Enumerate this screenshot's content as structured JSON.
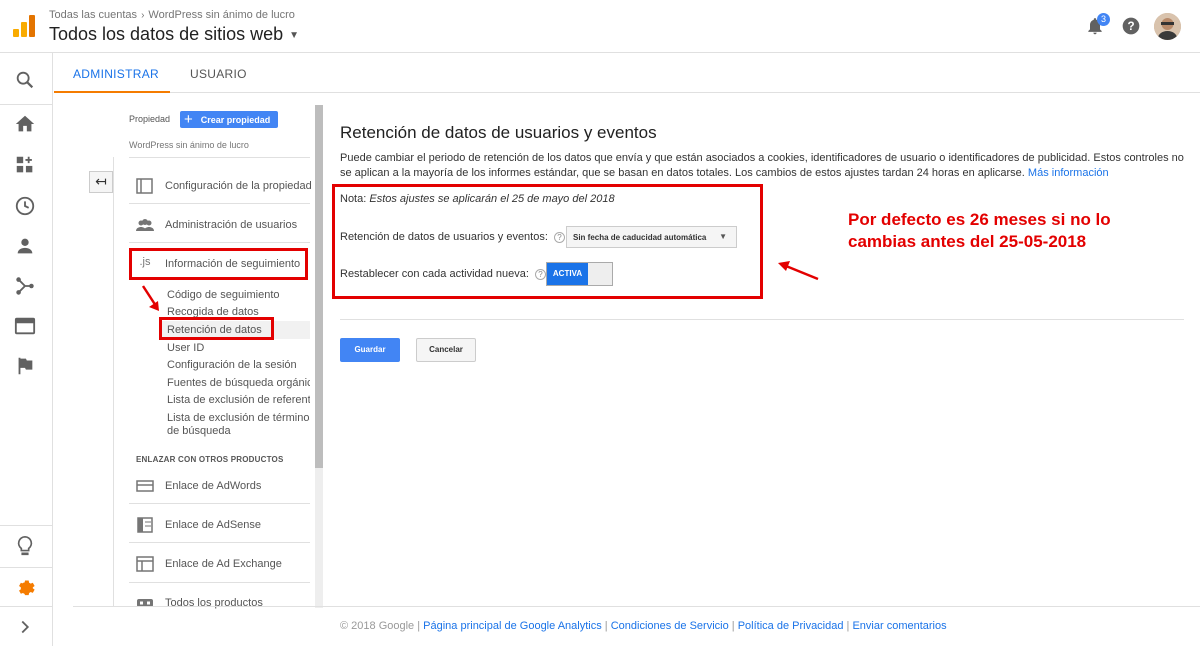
{
  "header": {
    "breadcrumb": [
      "Todas las cuentas",
      "WordPress sin ánimo de lucro"
    ],
    "title": "Todos los datos de sitios web",
    "notification_count": "3",
    "icons": [
      "analytics-logo",
      "bell-icon",
      "help-icon",
      "avatar"
    ]
  },
  "leftnav": {
    "icons": [
      "search-icon",
      "home-icon",
      "customization-icon",
      "clock-icon",
      "person-icon",
      "acquisition-icon",
      "behavior-icon",
      "flag-icon",
      "lightbulb-icon",
      "gear-icon",
      "expand-icon"
    ]
  },
  "tabs": {
    "admin": "ADMINISTRAR",
    "user": "USUARIO"
  },
  "property": {
    "label": "Propiedad",
    "create_button": "Crear propiedad",
    "name": "WordPress sin ánimo de lucro"
  },
  "menu": {
    "config": "Configuración de la propiedad",
    "users": "Administración de usuarios",
    "tracking": "Información de seguimiento",
    "tracking_icon": ".js",
    "subitems": {
      "code": "Código de seguimiento",
      "collection": "Recogida de datos",
      "retention": "Retención de datos",
      "userid": "User ID",
      "session": "Configuración de la sesión",
      "organic": "Fuentes de búsqueda orgánic",
      "referral": "Lista de exclusión de referent",
      "terms_1": "Lista de exclusión de términos",
      "terms_2": "de búsqueda"
    },
    "section_header": "ENLAZAR CON OTROS PRODUCTOS",
    "adwords": "Enlace de AdWords",
    "adsense": "Enlace de AdSense",
    "adexchange": "Enlace de Ad Exchange",
    "allproducts": "Todos los productos"
  },
  "main": {
    "title": "Retención de datos de usuarios y eventos",
    "description": "Puede cambiar el periodo de retención de los datos que envía y que están asociados a cookies, identificadores de usuario o identificadores de publicidad. Estos controles no se aplican a la mayoría de los informes estándar, que se basan en datos totales. Los cambios de estos ajustes tardan 24 horas en aplicarse.",
    "more_info": "Más información",
    "nota_label": "Nota:",
    "nota_text": "Estos ajustes se aplicarán el 25 de mayo del 2018",
    "retention_label": "Retención de datos de usuarios y eventos:",
    "retention_value": "Sin fecha de caducidad automática",
    "reset_label": "Restablecer con cada actividad nueva:",
    "toggle_state": "ACTIVA",
    "help_mark": "?",
    "save": "Guardar",
    "cancel": "Cancelar"
  },
  "annotation": {
    "line1": "Por defecto es 26 meses si no lo",
    "line2": "cambias antes del 25-05-2018"
  },
  "footer": {
    "copyright": "© 2018 Google",
    "links": [
      "Página principal de Google Analytics",
      "Condiciones de Servicio",
      "Política de Privacidad",
      "Enviar comentarios"
    ]
  },
  "colors": {
    "accent": "#4285f4",
    "annotation": "#e30000",
    "tab_underline": "#f57c00",
    "gear": "#f57c00"
  }
}
